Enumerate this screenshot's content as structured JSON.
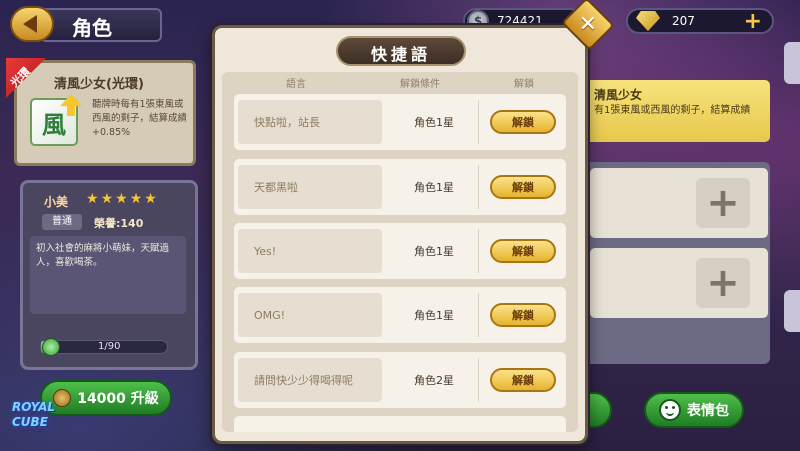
{
  "header": {
    "title": "角色",
    "coins": "724421",
    "gems": "207"
  },
  "left": {
    "ribbon_label": "光環",
    "skill": {
      "name": "清風少女(光環)",
      "description": "聽牌時每有1張東風或西風的剩子，結算成績+0.85%"
    },
    "character": {
      "name": "小美",
      "stars": 5,
      "rarity": "普通",
      "honor": "榮譽:140",
      "bio": "初入社會的麻將小萌妹，天賦過人，喜歡喝茶。"
    },
    "xp": {
      "text": "1/90",
      "fraction": 0.04
    },
    "upgrade_label": "14000 升級",
    "logo_line1": "ROYAL",
    "logo_line2": "CUBE"
  },
  "modal": {
    "title": "快捷語",
    "columns": [
      "語言",
      "解鎖條件",
      "解鎖"
    ],
    "rows": [
      {
        "phrase": "快點啦，站長",
        "condition": "角色1星",
        "action": "解鎖"
      },
      {
        "phrase": "天都黑啦",
        "condition": "角色1星",
        "action": "解鎖"
      },
      {
        "phrase": "Yes!",
        "condition": "角色1星",
        "action": "解鎖"
      },
      {
        "phrase": "OMG!",
        "condition": "角色1星",
        "action": "解鎖"
      },
      {
        "phrase": "請問快少少得喝得呢",
        "condition": "角色2星",
        "action": "解鎖"
      }
    ]
  },
  "right": {
    "skill_title": "清風少女",
    "skill_desc": "有1張東風或西風的剩子，結算成績",
    "sticker_label": "表情包"
  }
}
